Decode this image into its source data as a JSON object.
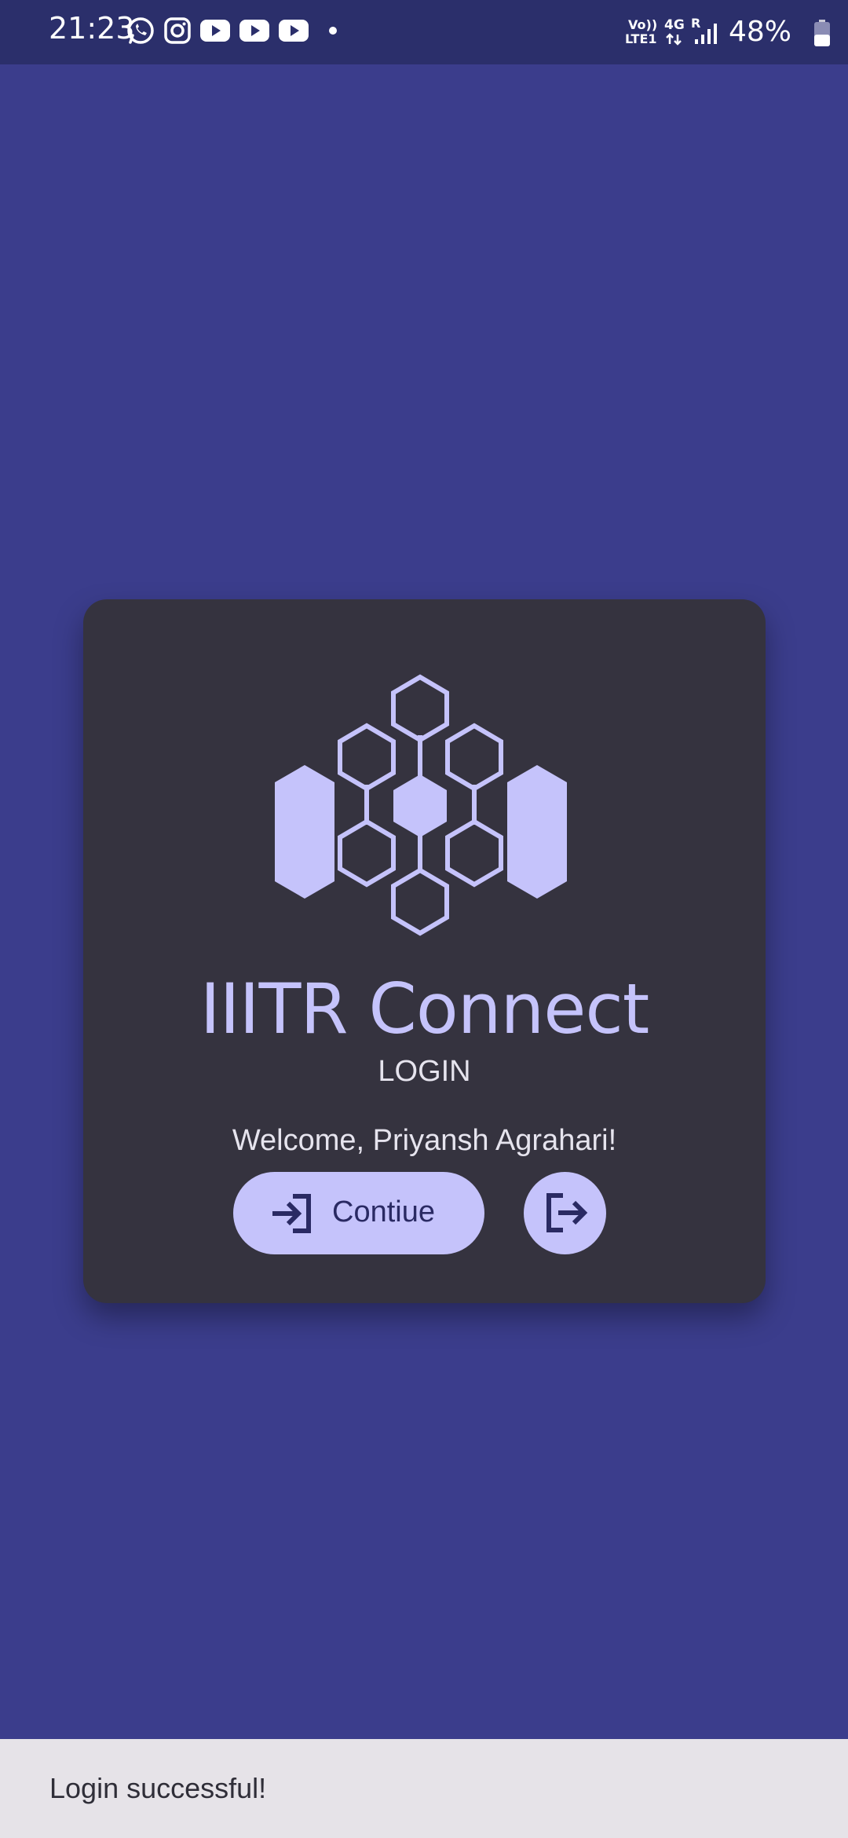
{
  "status_bar": {
    "time": "21:23",
    "notification_icons": [
      "whatsapp-icon",
      "instagram-icon",
      "youtube-icon",
      "youtube-icon",
      "youtube-icon",
      "dot-icon"
    ],
    "volte_label_top": "Vo))",
    "volte_label_bottom": "LTE1",
    "network_label": "4G",
    "roaming_label": "R",
    "battery_percent": "48%",
    "battery_level": 0.48
  },
  "card": {
    "app_title": "IIITR Connect",
    "screen_label": "LOGIN",
    "welcome_message": "Welcome, Priyansh Agrahari!",
    "continue_label": "Contiue",
    "continue_icon": "login-icon",
    "logout_icon": "logout-icon"
  },
  "snackbar": {
    "message": "Login successful!"
  },
  "colors": {
    "background": "#3b3d8c",
    "status_bar": "#2b2f6b",
    "card": "#35333f",
    "accent": "#c5c3fb",
    "accent_text": "#2a2a63",
    "snackbar": "#e6e3e8"
  }
}
